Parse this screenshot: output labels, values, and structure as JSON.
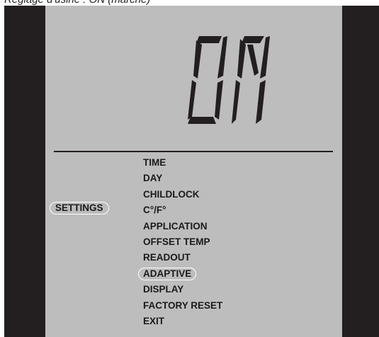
{
  "caption": "Réglage d'usine : ON (marche)",
  "display": {
    "value": "On",
    "segments": {
      "O": [
        "a",
        "b",
        "c",
        "d",
        "e",
        "f"
      ],
      "n": [
        "a",
        "b",
        "c",
        "e",
        "f"
      ]
    }
  },
  "sidebar": {
    "settings_label": "SETTINGS"
  },
  "menu": {
    "items": [
      {
        "label": "TIME",
        "selected": false
      },
      {
        "label": "DAY",
        "selected": false
      },
      {
        "label": "CHILDLOCK",
        "selected": false
      },
      {
        "label": "C°/F°",
        "selected": false
      },
      {
        "label": "APPLICATION",
        "selected": false
      },
      {
        "label": "OFFSET TEMP",
        "selected": false
      },
      {
        "label": "READOUT",
        "selected": false
      },
      {
        "label": "ADAPTIVE",
        "selected": true
      },
      {
        "label": "DISPLAY",
        "selected": false
      },
      {
        "label": "FACTORY RESET",
        "selected": false
      },
      {
        "label": "EXIT",
        "selected": false
      }
    ]
  },
  "colors": {
    "lcd_background": "#bdbdbd",
    "bezel": "#231f20",
    "segment": "#231f20",
    "highlight_outline": "#ffffff"
  }
}
